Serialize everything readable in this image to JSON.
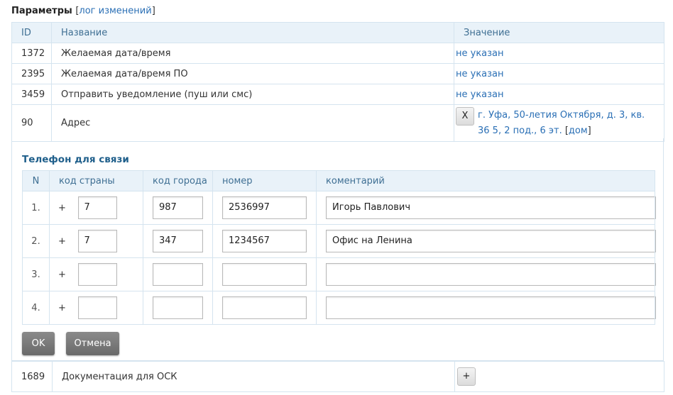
{
  "header": {
    "title": "Параметры",
    "bracket_open": "[",
    "log_link": "лог изменений",
    "bracket_close": "]"
  },
  "params_table": {
    "columns": [
      "ID",
      "Название",
      "Значение"
    ],
    "rows": [
      {
        "id": "1372",
        "name": "Желаемая дата/время",
        "value": "не указан"
      },
      {
        "id": "2395",
        "name": "Желаемая дата/время ПО",
        "value": "не указан"
      },
      {
        "id": "3459",
        "name": "Отправить уведомление (пуш или смс)",
        "value": "не указан"
      }
    ],
    "address_row": {
      "id": "90",
      "name": "Адрес",
      "clear_button": "X",
      "address_link": "г. Уфа, 50-летия Октября, д. 3, кв. 36 5, 2 под., 6 эт.",
      "bracket_open": " [",
      "home_link": "дом",
      "bracket_close": "]"
    }
  },
  "phone_section": {
    "title": "Телефон для связи",
    "columns": [
      "N",
      "код страны",
      "код города",
      "номер",
      "коментарий"
    ],
    "rows": [
      {
        "n": "1.",
        "plus": "+",
        "country": "7",
        "city": "987",
        "number": "2536997",
        "comment": "Игорь Павлович"
      },
      {
        "n": "2.",
        "plus": "+",
        "country": "7",
        "city": "347",
        "number": "1234567",
        "comment": "Офис на Ленина"
      },
      {
        "n": "3.",
        "plus": "+",
        "country": "",
        "city": "",
        "number": "",
        "comment": ""
      },
      {
        "n": "4.",
        "plus": "+",
        "country": "",
        "city": "",
        "number": "",
        "comment": ""
      }
    ],
    "ok_button": "OK",
    "cancel_button": "Отмена"
  },
  "bottom_row": {
    "id": "1689",
    "name": "Документация для ОСК",
    "add_button": "+"
  },
  "colors": {
    "link": "#2a6fb5",
    "header_bg": "#e9f2f9",
    "border": "#d5e4ef",
    "section_title": "#1f5f8b"
  }
}
